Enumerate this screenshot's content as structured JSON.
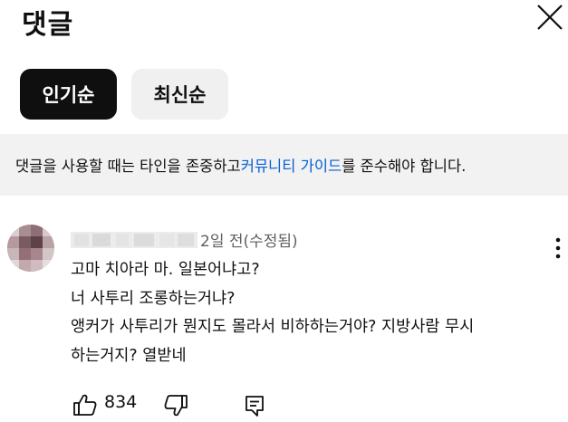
{
  "header": {
    "title": "댓글",
    "close_icon": "close-icon"
  },
  "sort": {
    "options": [
      {
        "label": "인기순",
        "selected": true
      },
      {
        "label": "최신순",
        "selected": false
      }
    ]
  },
  "notice": {
    "before": "댓글을 사용할 때는 타인을 존중하고 ",
    "link": "커뮤니티 가이드",
    "after": "를 준수해야 합니다.",
    "link_color": "#065fd4"
  },
  "comment": {
    "timestamp": "2일 전(수정됨)",
    "lines": [
      "고마 치아라 마.  일본어냐고?",
      "너 사투리 조롱하는거냐?",
      "앵커가 사투리가 뭔지도 몰라서 비하하는거야?   지방사람 무시",
      "하는거지?  열받네"
    ],
    "like_count": "834",
    "icons": [
      "thumbs-up-icon",
      "thumbs-down-icon",
      "reply-icon",
      "more-vert-icon"
    ]
  }
}
